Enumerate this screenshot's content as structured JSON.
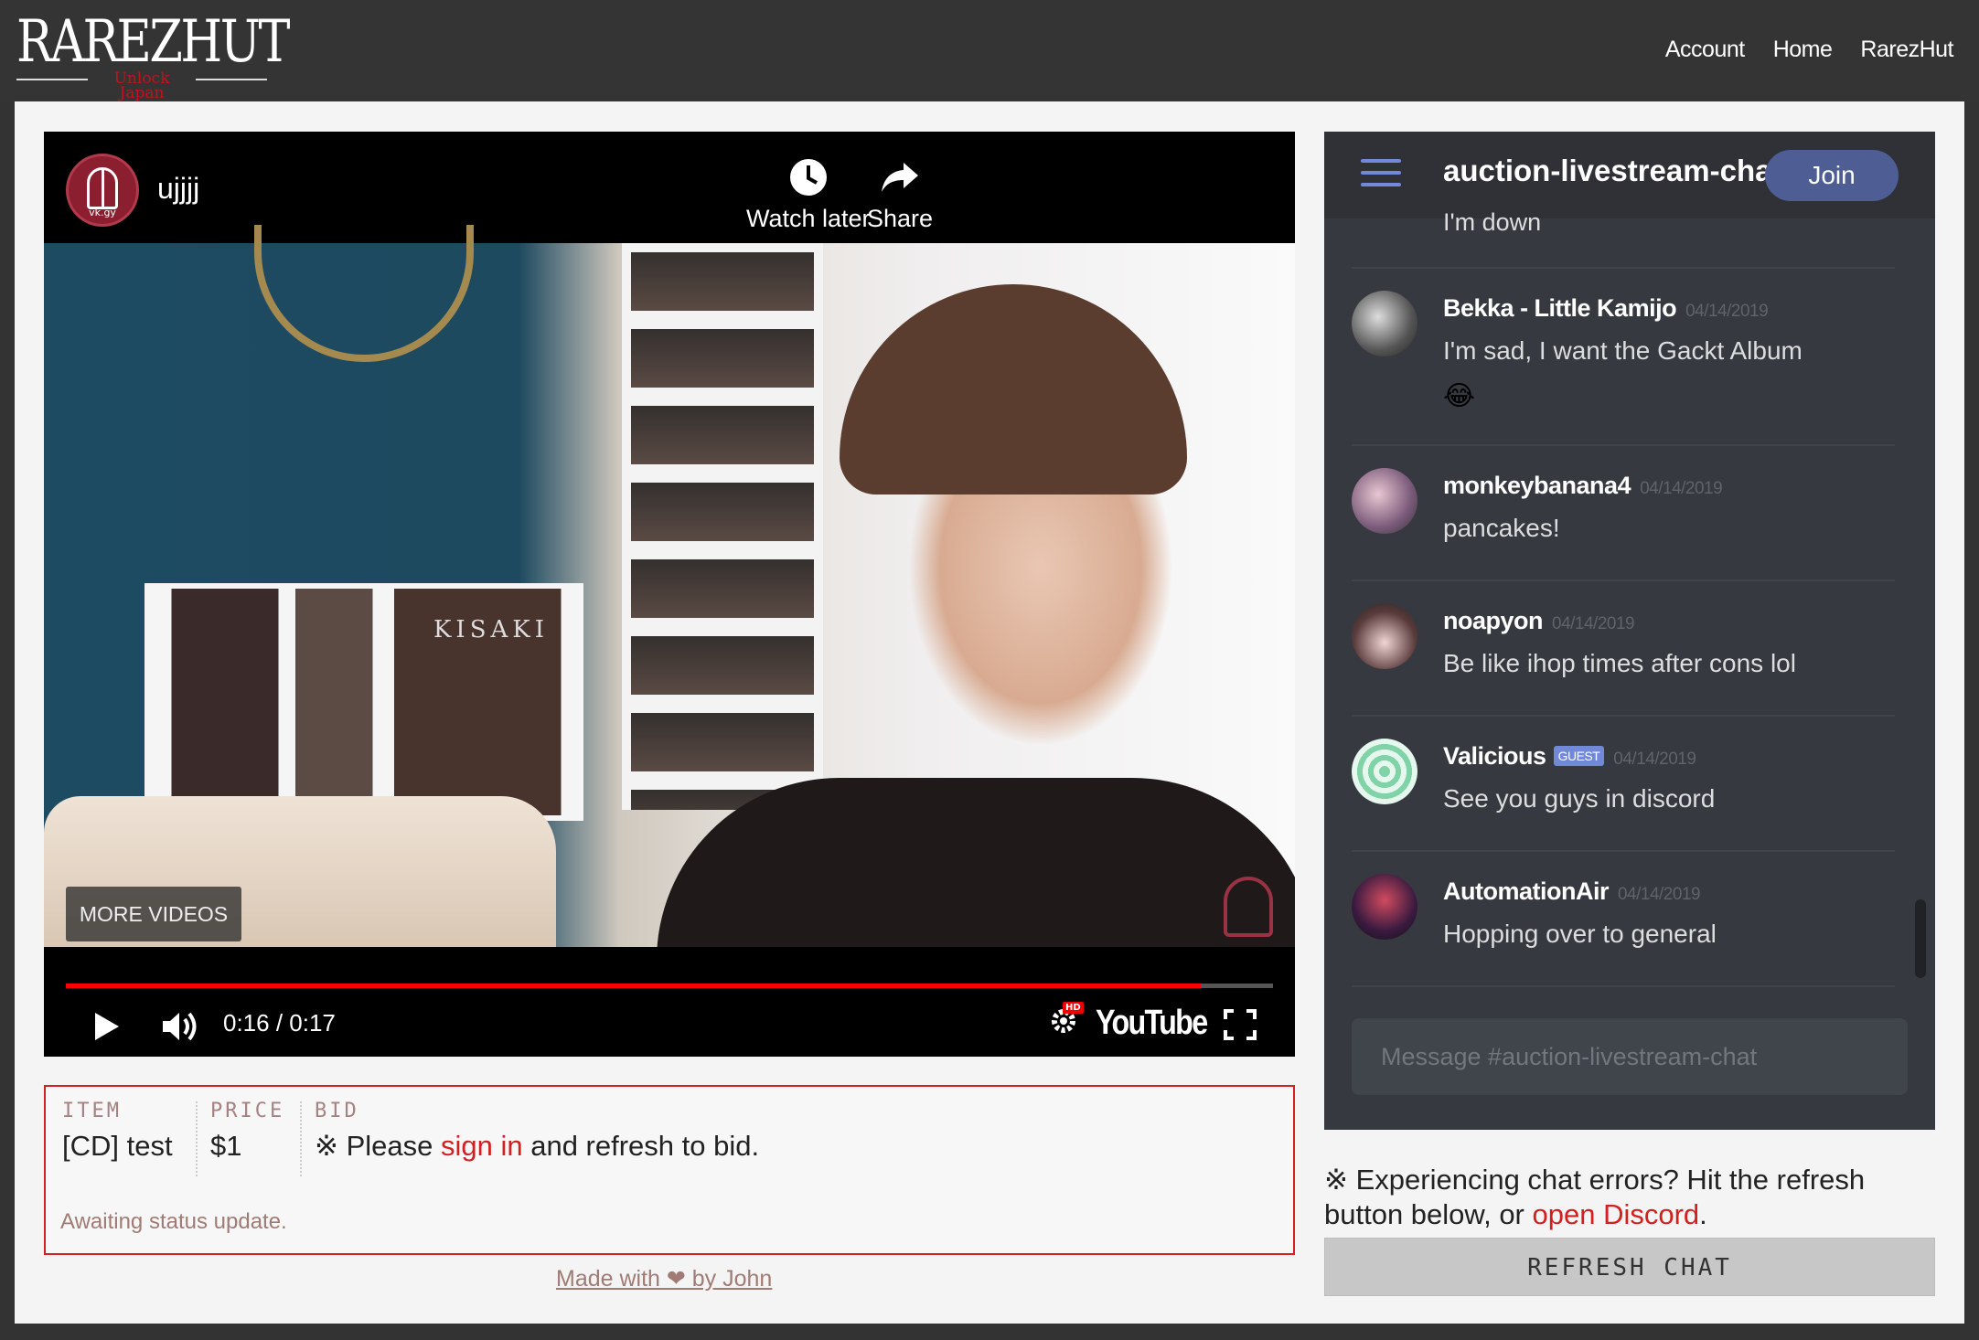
{
  "header": {
    "logo_main": "RAREZHUT",
    "logo_sub": "Unlock Japan",
    "nav": [
      "Account",
      "Home",
      "RarezHut"
    ]
  },
  "video": {
    "channel_name": "ujjjj",
    "channel_tag": "vk.gy",
    "watch_later_label": "Watch later",
    "share_label": "Share",
    "more_videos_label": "MORE VIDEOS",
    "poster_text": "KISAKI",
    "time": "0:16 / 0:17",
    "progress_fraction": 0.94,
    "youtube_label": "YouTube",
    "hd_badge": "HD"
  },
  "bid": {
    "item_header": "ITEM",
    "item_value": "[CD] test",
    "price_header": "PRICE",
    "price_value": "$1",
    "bid_header": "BID",
    "bid_prefix": "※ Please ",
    "bid_link": "sign in",
    "bid_suffix": " and refresh to bid.",
    "status": "Awaiting status update."
  },
  "footer": {
    "text": "Made with ❤ by John"
  },
  "chat": {
    "title": "auction-livestream-chat",
    "join_label": "Join",
    "partial_message": "I'm down",
    "messages": [
      {
        "user": "Bekka - Little Kamijo",
        "time": "04/14/2019",
        "text": "I'm sad, I want the Gackt Album",
        "emoji": "😂"
      },
      {
        "user": "monkeybanana4",
        "time": "04/14/2019",
        "text": "pancakes!"
      },
      {
        "user": "noapyon",
        "time": "04/14/2019",
        "text": "Be like ihop times after cons lol"
      },
      {
        "user": "Valicious",
        "badge": "GUEST",
        "time": "04/14/2019",
        "text": "See you guys in discord"
      },
      {
        "user": "AutomationAir",
        "time": "04/14/2019",
        "text": "Hopping over to general"
      }
    ],
    "input_placeholder": "Message #auction-livestream-chat"
  },
  "chat_note": {
    "prefix": "※ Experiencing chat errors? Hit the refresh button below, or ",
    "link": "open Discord",
    "suffix": "."
  },
  "refresh_label": "REFRESH CHAT",
  "colors": {
    "accent": "#d21f1f",
    "discord_blurple": "#7289da",
    "topbar": "#343434"
  }
}
